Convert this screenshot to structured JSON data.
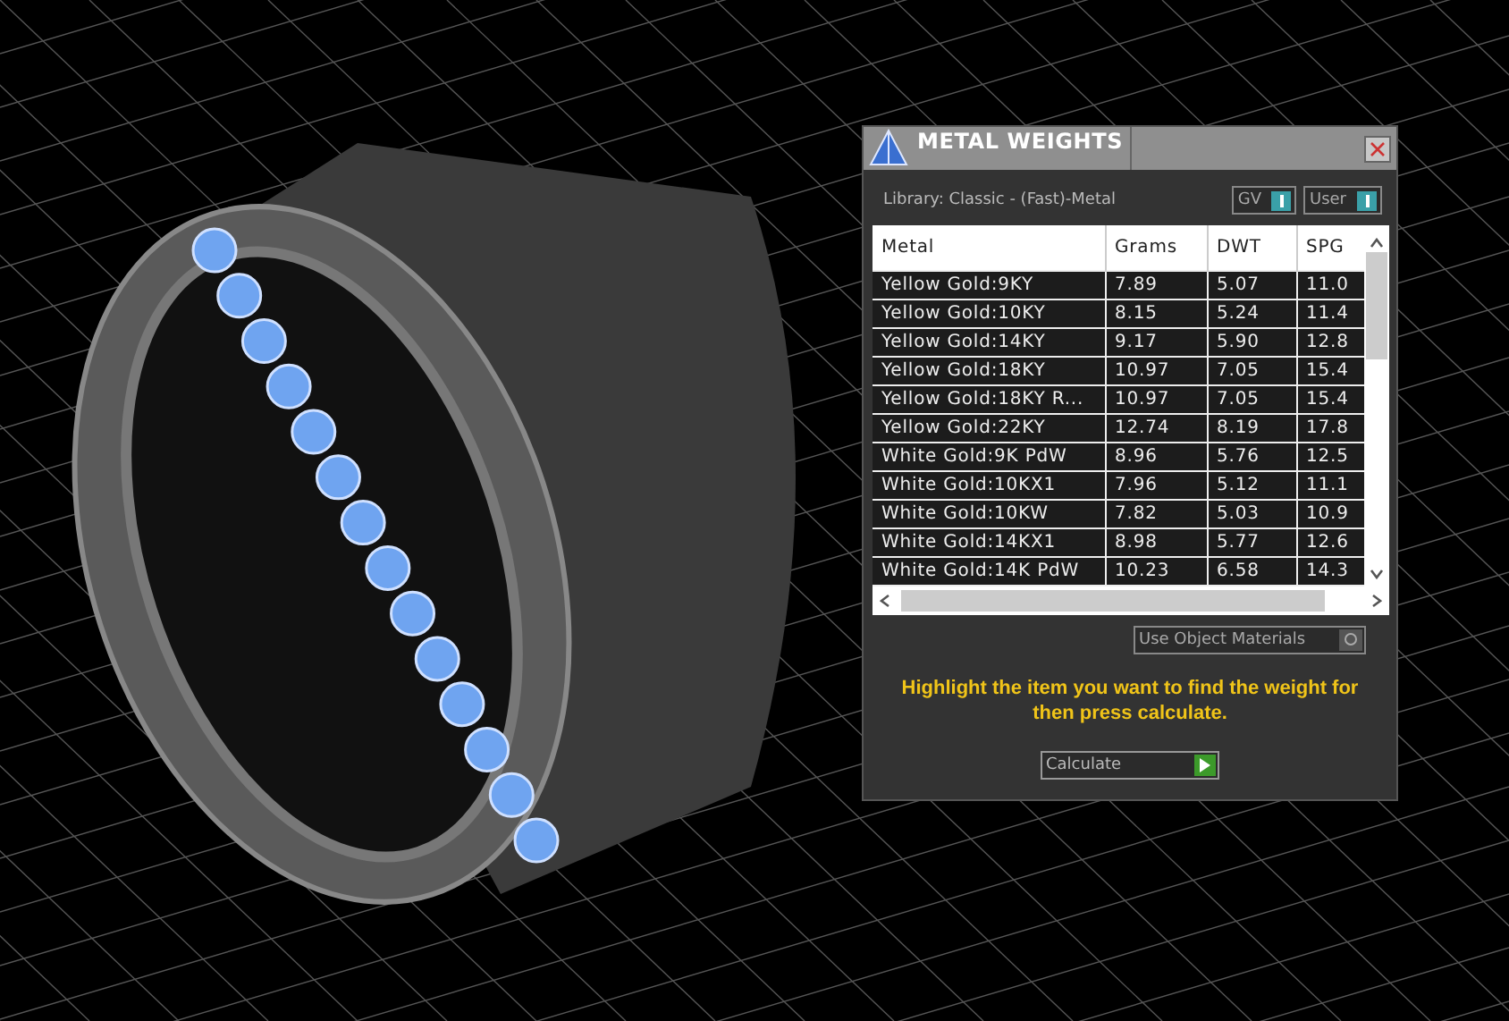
{
  "panel": {
    "title": "METAL WEIGHTS",
    "library": "Library: Classic - (Fast)-Metal",
    "toggles": [
      {
        "label": "GV",
        "on": true
      },
      {
        "label": "User",
        "on": true
      }
    ],
    "table": {
      "columns": [
        "Metal",
        "Grams",
        "DWT",
        "SPG"
      ],
      "rows": [
        [
          "Yellow Gold:9KY",
          "7.89",
          "5.07",
          "11.0"
        ],
        [
          "Yellow Gold:10KY",
          "8.15",
          "5.24",
          "11.4"
        ],
        [
          "Yellow Gold:14KY",
          "9.17",
          "5.90",
          "12.8"
        ],
        [
          "Yellow Gold:18KY",
          "10.97",
          "7.05",
          "15.4"
        ],
        [
          "Yellow Gold:18KY R...",
          "10.97",
          "7.05",
          "15.4"
        ],
        [
          "Yellow Gold:22KY",
          "12.74",
          "8.19",
          "17.8"
        ],
        [
          "White Gold:9K PdW",
          "8.96",
          "5.76",
          "12.5"
        ],
        [
          "White Gold:10KX1",
          "7.96",
          "5.12",
          "11.1"
        ],
        [
          "White Gold:10KW",
          "7.82",
          "5.03",
          "10.9"
        ],
        [
          "White Gold:14KX1",
          "8.98",
          "5.77",
          "12.6"
        ],
        [
          "White Gold:14K PdW",
          "10.23",
          "6.58",
          "14.3"
        ]
      ]
    },
    "use_object_materials": {
      "label": "Use Object Materials",
      "on": false
    },
    "hint": "Highlight the item you want to find the weight for then press calculate.",
    "calculate": "Calculate"
  }
}
